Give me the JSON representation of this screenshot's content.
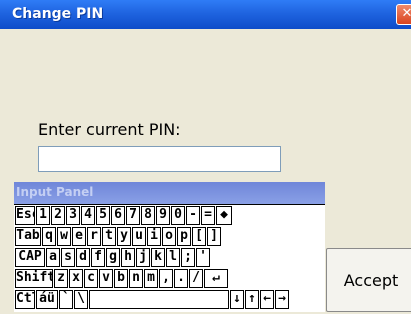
{
  "window": {
    "title": "Change PIN",
    "close_glyph": "✕"
  },
  "form": {
    "label": "Enter current PIN:",
    "pin_value": "",
    "accept_label": "Accept"
  },
  "input_panel": {
    "title": "Input Panel",
    "rows": [
      [
        {
          "label": "Esc",
          "name": "key-esc"
        },
        {
          "label": "1",
          "name": "key-1"
        },
        {
          "label": "2",
          "name": "key-2"
        },
        {
          "label": "3",
          "name": "key-3"
        },
        {
          "label": "4",
          "name": "key-4"
        },
        {
          "label": "5",
          "name": "key-5"
        },
        {
          "label": "6",
          "name": "key-6"
        },
        {
          "label": "7",
          "name": "key-7"
        },
        {
          "label": "8",
          "name": "key-8"
        },
        {
          "label": "9",
          "name": "key-9"
        },
        {
          "label": "0",
          "name": "key-0"
        },
        {
          "label": "-",
          "name": "key-minus"
        },
        {
          "label": "=",
          "name": "key-equals"
        },
        {
          "label": "◆",
          "name": "key-backspace",
          "icon": "backspace-icon"
        }
      ],
      [
        {
          "label": "Tab",
          "name": "key-tab"
        },
        {
          "label": "q",
          "name": "key-q"
        },
        {
          "label": "w",
          "name": "key-w"
        },
        {
          "label": "e",
          "name": "key-e"
        },
        {
          "label": "r",
          "name": "key-r"
        },
        {
          "label": "t",
          "name": "key-t"
        },
        {
          "label": "y",
          "name": "key-y"
        },
        {
          "label": "u",
          "name": "key-u"
        },
        {
          "label": "i",
          "name": "key-i"
        },
        {
          "label": "o",
          "name": "key-o"
        },
        {
          "label": "p",
          "name": "key-p"
        },
        {
          "label": "[",
          "name": "key-left-bracket"
        },
        {
          "label": "]",
          "name": "key-right-bracket"
        }
      ],
      [
        {
          "label": "CAP",
          "name": "key-caps"
        },
        {
          "label": "a",
          "name": "key-a"
        },
        {
          "label": "s",
          "name": "key-s"
        },
        {
          "label": "d",
          "name": "key-d"
        },
        {
          "label": "f",
          "name": "key-f"
        },
        {
          "label": "g",
          "name": "key-g"
        },
        {
          "label": "h",
          "name": "key-h"
        },
        {
          "label": "j",
          "name": "key-j"
        },
        {
          "label": "k",
          "name": "key-k"
        },
        {
          "label": "l",
          "name": "key-l"
        },
        {
          "label": ";",
          "name": "key-semicolon"
        },
        {
          "label": "'",
          "name": "key-quote"
        }
      ],
      [
        {
          "label": "Shift",
          "name": "key-shift"
        },
        {
          "label": "z",
          "name": "key-z"
        },
        {
          "label": "x",
          "name": "key-x"
        },
        {
          "label": "c",
          "name": "key-c"
        },
        {
          "label": "v",
          "name": "key-v"
        },
        {
          "label": "b",
          "name": "key-b"
        },
        {
          "label": "n",
          "name": "key-n"
        },
        {
          "label": "m",
          "name": "key-m"
        },
        {
          "label": ",",
          "name": "key-comma"
        },
        {
          "label": ".",
          "name": "key-period"
        },
        {
          "label": "/",
          "name": "key-slash"
        },
        {
          "label": "↵",
          "name": "key-enter",
          "icon": "enter-icon"
        }
      ],
      [
        {
          "label": "Ctl",
          "name": "key-ctrl"
        },
        {
          "label": "áü",
          "name": "key-intl"
        },
        {
          "label": "`",
          "name": "key-backtick"
        },
        {
          "label": "\\",
          "name": "key-backslash"
        },
        {
          "label": "",
          "name": "key-space"
        },
        {
          "label": "↓",
          "name": "key-down",
          "icon": "arrow-down-icon"
        },
        {
          "label": "↑",
          "name": "key-up",
          "icon": "arrow-up-icon"
        },
        {
          "label": "←",
          "name": "key-left",
          "icon": "arrow-left-icon"
        },
        {
          "label": "→",
          "name": "key-right",
          "icon": "arrow-right-icon"
        }
      ]
    ]
  }
}
